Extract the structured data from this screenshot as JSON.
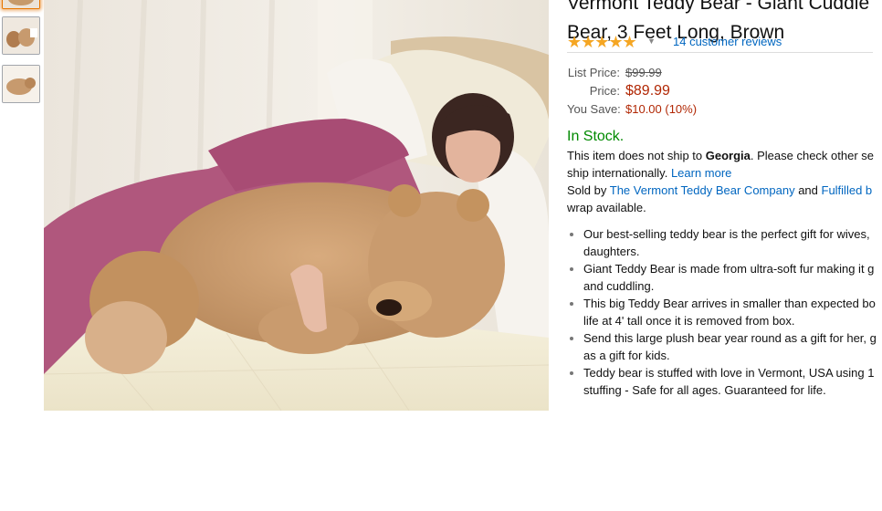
{
  "product": {
    "title_line1": "Vermont Teddy Bear - Giant Cuddle",
    "title_line2": "Bear, 3 Feet Long, Brown",
    "stars_display": "★★★★★",
    "rating": 4.5,
    "reviews_link": "14 customer reviews"
  },
  "pricing": {
    "list_price_label": "List Price:",
    "list_price": "$99.99",
    "price_label": "Price:",
    "price": "$89.99",
    "you_save_label": "You Save:",
    "you_save": "$10.00 (10%)"
  },
  "availability": {
    "status": "In Stock.",
    "ship_text_1": "This item does not ship to ",
    "ship_location": "Georgia",
    "ship_text_2": ". Please check other se",
    "ship_text_3": "ship internationally. ",
    "learn_more": "Learn more",
    "sold_by_prefix": "Sold by ",
    "seller": "The Vermont Teddy Bear Company",
    "sold_by_and": " and ",
    "fulfilled": "Fulfilled b",
    "gift_wrap": "wrap available."
  },
  "features": [
    {
      "line1": "Our best-selling teddy bear is the perfect gift for wives,",
      "line2": "daughters."
    },
    {
      "line1": "Giant Teddy Bear is made from ultra-soft fur making it g",
      "line2": "and cuddling."
    },
    {
      "line1": "This big Teddy Bear arrives in smaller than expected bo",
      "line2": "life at 4' tall once it is removed from box."
    },
    {
      "line1": "Send this large plush bear year round as a gift for her, g",
      "line2": "as a gift for kids."
    },
    {
      "line1": "Teddy bear is stuffed with love in Vermont, USA using 1",
      "line2": "stuffing - Safe for all ages. Guaranteed for life."
    }
  ],
  "colors": {
    "link": "#0066c0",
    "price": "#b12704",
    "in_stock": "#008a00",
    "star": "#f5a623"
  }
}
